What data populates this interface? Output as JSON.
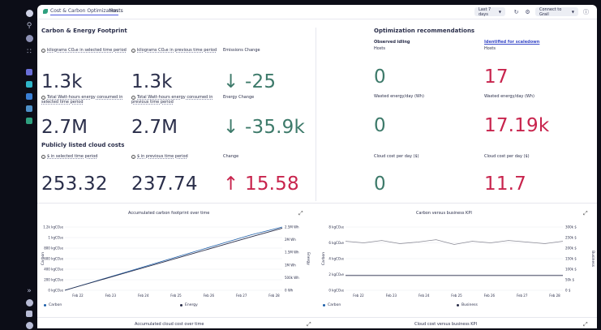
{
  "colors": {
    "accent": "#4f5ae0",
    "green": "#3d7a6a",
    "red": "#c8244d",
    "series_blue": "#1c5ea8",
    "series_dark": "#2a2e4a",
    "series_gray": "#8a8a95"
  },
  "topbar": {
    "breadcrumb_app": "Cost & Carbon Optimization",
    "breadcrumb_page": "Hosts",
    "timeframe": "Last 7 days",
    "refresh_icon": "refresh-icon",
    "settings_icon": "gear-icon",
    "connect_label": "Connect to Grail",
    "help_icon": "help-icon"
  },
  "footprint": {
    "title": "Carbon & Energy Footprint",
    "kpis": [
      {
        "label": "kilograms CO₂e in selected time period",
        "value": "1.3k"
      },
      {
        "label": "kilograms CO₂e in previous time period",
        "value": "1.3k"
      },
      {
        "label": "Emissions Change",
        "value": "↓ -25"
      },
      {
        "label": "Total Watt-hours energy consumed in selected time period",
        "value": "2.7M"
      },
      {
        "label": "Total Watt-hours energy consumed in previous time period",
        "value": "2.7M"
      },
      {
        "label": "Energy Change",
        "value": "↓ -35.9k"
      }
    ]
  },
  "cloud_costs": {
    "title": "Publicly listed cloud costs",
    "kpis": [
      {
        "label": "$ in selected time period",
        "value": "253.32"
      },
      {
        "label": "$ in previous time period",
        "value": "237.74"
      },
      {
        "label": "Change",
        "value": "↑ 15.58"
      }
    ]
  },
  "optimization": {
    "title": "Optimization recommendations",
    "col1_header": "Observed idling",
    "col1_sub": "Hosts",
    "col1_hosts": "0",
    "col1_wasted_label": "Wasted energy/day (Wh)",
    "col1_wasted": "0",
    "col1_cost_label": "Cloud cost per day ($)",
    "col1_cost": "0",
    "col2_header": "Identified for scaledown",
    "col2_sub": "Hosts",
    "col2_hosts": "17",
    "col2_wasted_label": "Wasted energy/day (Wh)",
    "col2_wasted": "17.19k",
    "col2_cost_label": "Cloud cost per day ($)",
    "col2_cost": "11.7"
  },
  "chart_data": [
    {
      "type": "line",
      "title": "Accumulated carbon footprint over time",
      "ylabel": "Carbon",
      "y2label": "Energy",
      "x": [
        "Feb 22",
        "Feb 23",
        "Feb 24",
        "Feb 25",
        "Feb 26",
        "Feb 27",
        "Feb 28"
      ],
      "yticks": [
        "0 kgCO₂e",
        "200 kgCO₂e",
        "400 kgCO₂e",
        "600 kgCO₂e",
        "800 kgCO₂e",
        "1 kgCO₂e",
        "1.2k kgCO₂e"
      ],
      "y2ticks": [
        "0 Wh",
        "500k Wh",
        "1M Wh",
        "1.5M Wh",
        "2M Wh",
        "2.5M Wh"
      ],
      "ylim": [
        0,
        1300
      ],
      "y2lim": [
        0,
        2700000
      ],
      "series": [
        {
          "name": "Carbon",
          "values": [
            0,
            190,
            380,
            570,
            760,
            950,
            1140,
            1300
          ]
        },
        {
          "name": "Energy",
          "values": [
            0,
            380000,
            760000,
            1140000,
            1520000,
            1900000,
            2280000,
            2650000
          ]
        }
      ],
      "legend": "bottom"
    },
    {
      "type": "line",
      "title": "Carbon versus business KPI",
      "ylabel": "Carbon",
      "y2label": "Business",
      "x": [
        "Feb 22",
        "Feb 23",
        "Feb 24",
        "Feb 25",
        "Feb 26",
        "Feb 27",
        "Feb 28"
      ],
      "yticks": [
        "0 kgCO₂e",
        "2 kgCO₂e",
        "4 kgCO₂e",
        "6 kgCO₂e",
        "8 kgCO₂e"
      ],
      "y2ticks": [
        "0 $",
        "50k $",
        "100k $",
        "150k $",
        "200k $",
        "250k $",
        "300k $"
      ],
      "ylim": [
        0,
        8
      ],
      "y2lim": [
        0,
        300000
      ],
      "series": [
        {
          "name": "Carbon",
          "values": [
            6.2,
            6.0,
            6.3,
            5.9,
            6.1,
            6.4,
            5.8,
            6.2,
            6.0,
            6.3,
            6.1,
            5.9,
            6.2
          ]
        },
        {
          "name": "Business",
          "values": [
            70000,
            70000,
            70000,
            70000,
            70000,
            70000,
            70000,
            70000,
            70000,
            70000,
            70000,
            70000,
            70000
          ]
        }
      ],
      "legend": "bottom"
    }
  ],
  "bottom_charts": {
    "left_title": "Accumulated cloud cost over time",
    "right_title": "Cloud cost versus business KPI"
  }
}
